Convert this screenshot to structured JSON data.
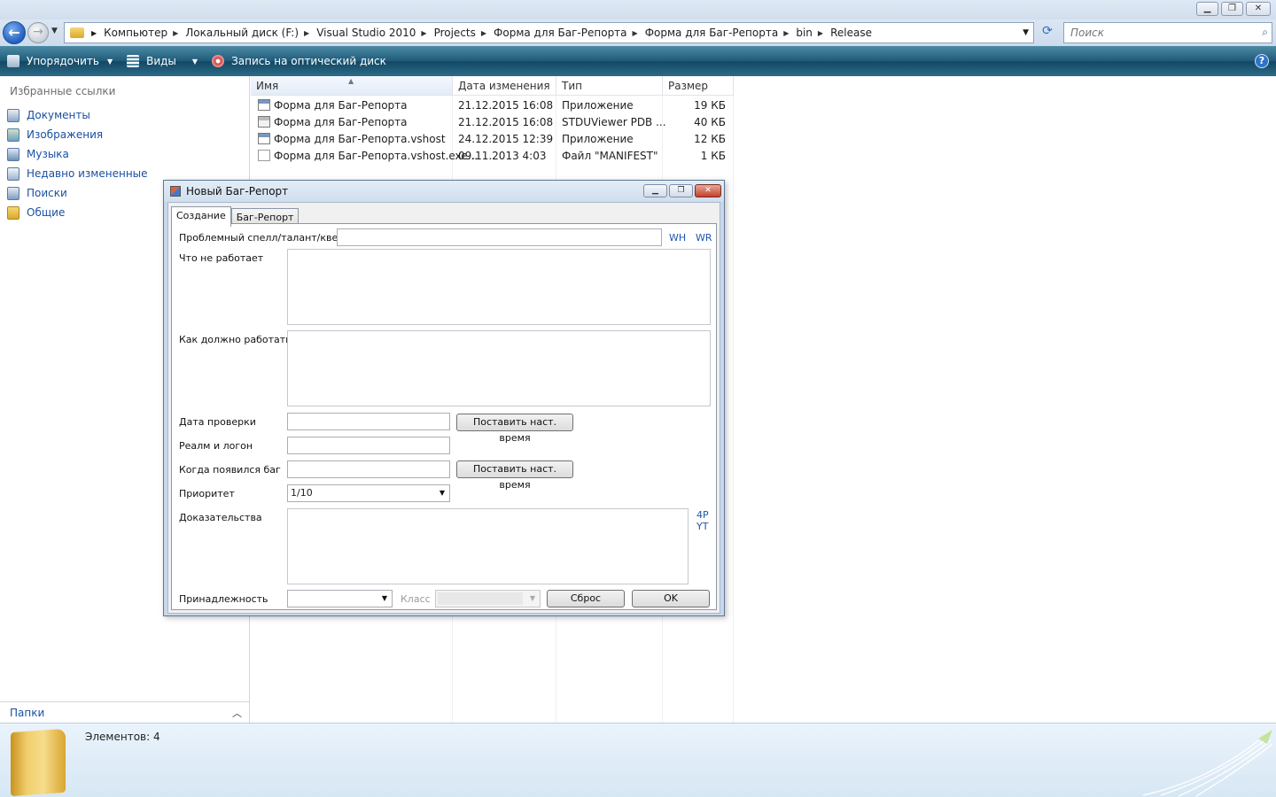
{
  "explorer": {
    "breadcrumb": [
      "Компьютер",
      "Локальный диск (F:)",
      "Visual Studio 2010",
      "Projects",
      "Форма для Баг-Репорта",
      "Форма для Баг-Репорта",
      "bin",
      "Release"
    ],
    "search_placeholder": "Поиск",
    "toolbar": {
      "organize": "Упорядочить",
      "views": "Виды",
      "burn": "Запись на оптический диск"
    },
    "favorites_title": "Избранные ссылки",
    "favorites": [
      "Документы",
      "Изображения",
      "Музыка",
      "Недавно измененные",
      "Поиски",
      "Общие"
    ],
    "folders_label": "Папки",
    "columns": [
      "Имя",
      "Дата изменения",
      "Тип",
      "Размер"
    ],
    "files": [
      {
        "name": "Форма для Баг-Репорта",
        "date": "21.12.2015 16:08",
        "type": "Приложение",
        "size": "19 КБ",
        "icon": "app-icon"
      },
      {
        "name": "Форма для Баг-Репорта",
        "date": "21.12.2015 16:08",
        "type": "STDUViewer PDB ...",
        "size": "40 КБ",
        "icon": "pdb-icon"
      },
      {
        "name": "Форма для Баг-Репорта.vshost",
        "date": "24.12.2015 12:39",
        "type": "Приложение",
        "size": "12 КБ",
        "icon": "app-icon"
      },
      {
        "name": "Форма для Баг-Репорта.vshost.exe...",
        "date": "09.11.2013 4:03",
        "type": "Файл \"MANIFEST\"",
        "size": "1 КБ",
        "icon": "file-icon"
      }
    ],
    "status": "Элементов: 4"
  },
  "dialog": {
    "title": "Новый Баг-Репорт",
    "tabs": [
      "Создание",
      "Баг-Репорт"
    ],
    "fields": {
      "spell_label": "Проблемный спелл/талант/квест",
      "link_wh": "WH",
      "link_wr": "WR",
      "not_working_label": "Что не работает",
      "should_work_label": "Как должно работать",
      "check_date_label": "Дата проверки",
      "set_time_button": "Поставить наст. время",
      "realm_label": "Реалм и логон",
      "bug_appeared_label": "Когда появился баг",
      "set_time_button2": "Поставить наст. время",
      "priority_label": "Приоритет",
      "priority_value": "1/10",
      "evidence_label": "Доказательства",
      "link_4p": "4P",
      "link_yt": "YT",
      "belonging_label": "Принадлежность",
      "class_label": "Класс",
      "reset_button": "Сброс",
      "ok_button": "OK"
    }
  },
  "colors": {
    "toolbar_bg": "#1f5a78",
    "link_blue": "#1b4fa3",
    "dialog_frame": "#c8d8ea"
  }
}
